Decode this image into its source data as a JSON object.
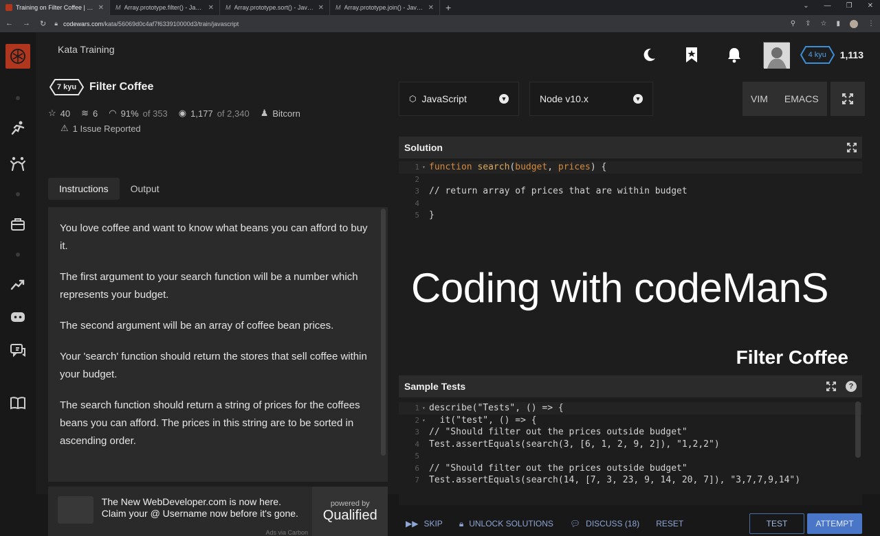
{
  "browser": {
    "tabs": [
      {
        "title": "Training on Filter Coffee | Codewars",
        "active": true
      },
      {
        "title": "Array.prototype.filter() - JavaScript",
        "active": false
      },
      {
        "title": "Array.prototype.sort() - JavaScript",
        "active": false
      },
      {
        "title": "Array.prototype.join() - JavaScript",
        "active": false
      }
    ],
    "url_host": "codewars.com",
    "url_path": "/kata/56069d0c4af7f633910000d3/train/javascript"
  },
  "topbar": {
    "breadcrumb": "Kata Training",
    "rank_label": "4 kyu",
    "honor": "1,113"
  },
  "kata": {
    "kyu": "7 kyu",
    "name": "Filter Coffee",
    "stars": "40",
    "collections": "6",
    "satisfaction": "91%",
    "satisfaction_of": "of 353",
    "completed": "1,177",
    "completed_of": "of 2,340",
    "author": "Bitcorn",
    "issues": "1 Issue Reported"
  },
  "left_tabs": [
    "Instructions",
    "Output"
  ],
  "instructions": [
    "You love coffee and want to know what beans you can afford to buy it.",
    "The first argument to your search function will be a number which represents your budget.",
    "The second argument will be an array of coffee bean prices.",
    "Your 'search' function should return the stores that sell coffee within your budget.",
    "The search function should return a string of prices for the coffees beans you can afford. The prices in this string are to be sorted in ascending order."
  ],
  "ad": {
    "line1": "The New WebDeveloper.com is now here.",
    "line2": "Claim your @ Username now before it's gone.",
    "powered_by": "powered by",
    "brand": "Qualified",
    "via": "Ads via Carbon"
  },
  "editor": {
    "language": "JavaScript",
    "runtime": "Node v10.x",
    "modes": [
      "VIM",
      "EMACS"
    ]
  },
  "solution": {
    "title": "Solution",
    "lines": [
      "1",
      "2",
      "3",
      "4",
      "5"
    ],
    "comment": "// return array of prices that are within budget"
  },
  "overlay": {
    "title": "Coding with codeManS",
    "subtitle": "Filter Coffee"
  },
  "tests": {
    "title": "Sample Tests",
    "lines": [
      "1",
      "2",
      "3",
      "4",
      "5",
      "6",
      "7"
    ],
    "comment1": "// \"Should filter out the prices outside budget\"",
    "comment2": "// \"Should filter out the prices outside budget\"",
    "assert1_args": "(3, [6, 1, 2, 9, 2])",
    "assert1_expected": "\"1,2,2\"",
    "assert2_args": "(14, [7, 3, 23, 9, 14, 20, 7])",
    "assert2_expected": "\"3,7,7,9,14\""
  },
  "actions": {
    "skip": "SKIP",
    "unlock": "UNLOCK SOLUTIONS",
    "discuss": "DISCUSS (18)",
    "reset": "RESET",
    "test": "TEST",
    "attempt": "ATTEMPT"
  }
}
